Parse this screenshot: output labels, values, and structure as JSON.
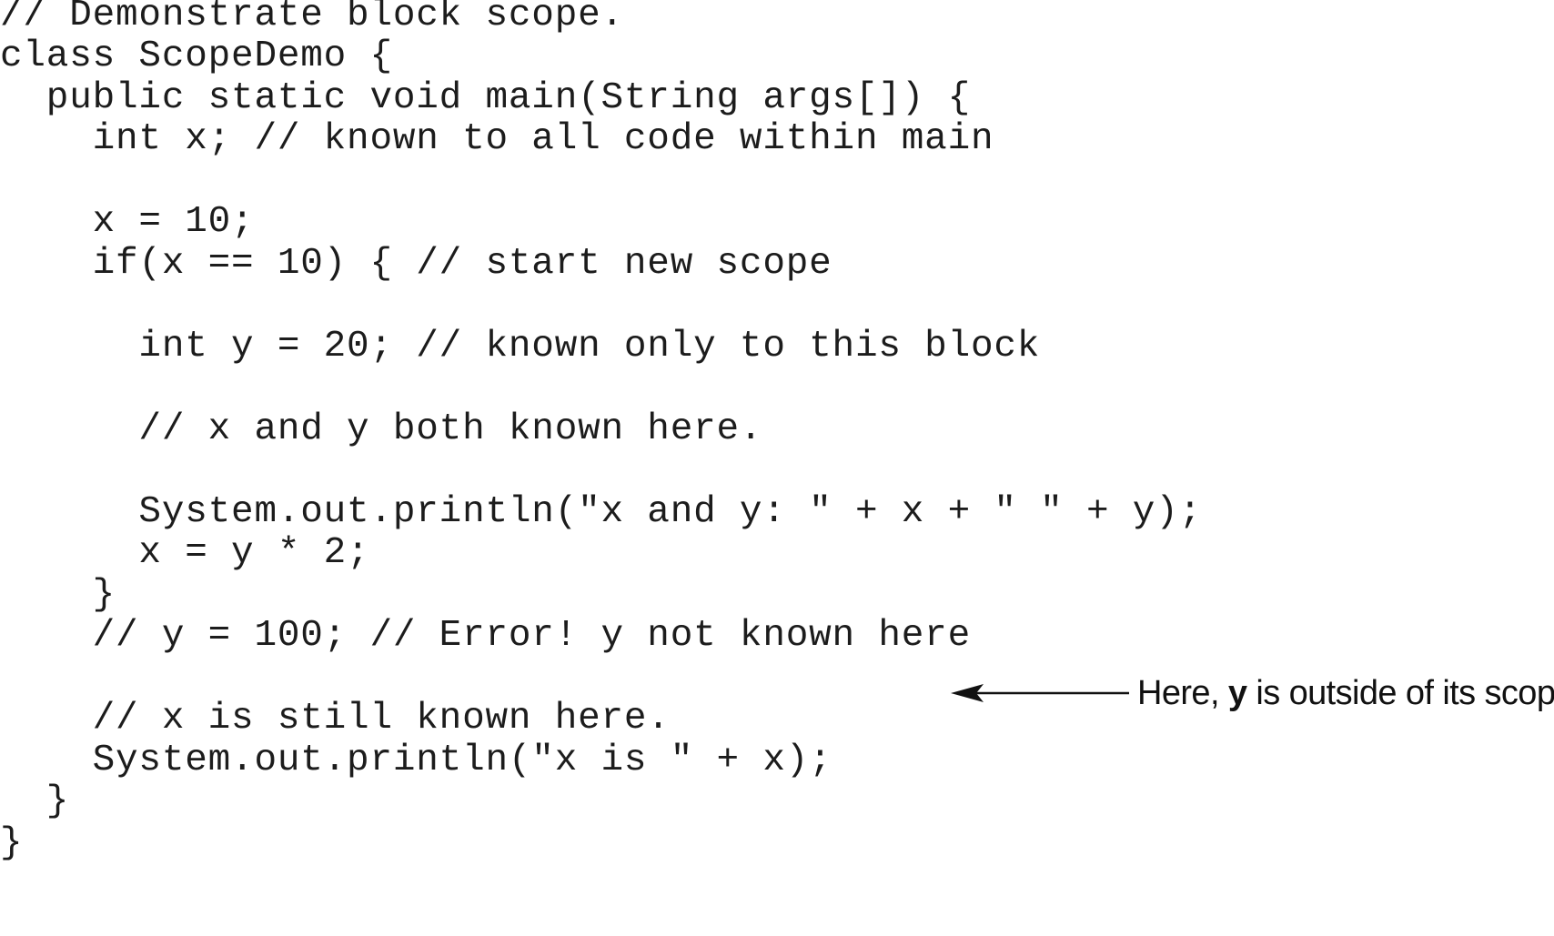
{
  "code": {
    "lines": [
      "// Demonstrate block scope.",
      "class ScopeDemo {",
      "  public static void main(String args[]) {",
      "    int x; // known to all code within main",
      "",
      "    x = 10;",
      "    if(x == 10) { // start new scope",
      "",
      "      int y = 20; // known only to this block",
      "",
      "      // x and y both known here.",
      "",
      "      System.out.println(\"x and y: \" + x + \" \" + y);",
      "      x = y * 2;",
      "    }",
      "    // y = 100; // Error! y not known here",
      "",
      "    // x is still known here.",
      "    System.out.println(\"x is \" + x);",
      "  }",
      "}"
    ]
  },
  "annotation": {
    "prefix": "Here, ",
    "emphasis": "y",
    "suffix": " is outside of its scope.",
    "arrow_icon": "left-arrow-icon"
  }
}
